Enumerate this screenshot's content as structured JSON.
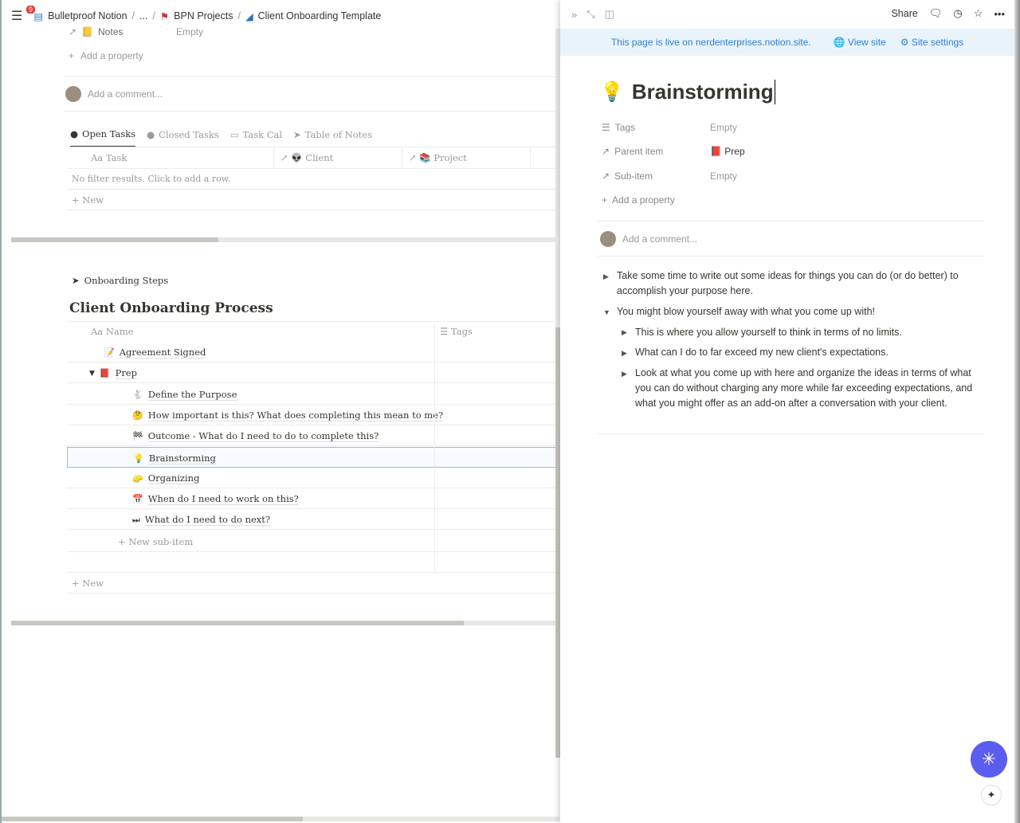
{
  "breadcrumb": {
    "badge": "9",
    "items": [
      "Bulletproof Notion",
      "...",
      "BPN Projects",
      "Client Onboarding Template"
    ]
  },
  "left": {
    "notes_prop": {
      "label": "Notes",
      "value": "Empty"
    },
    "add_property": "Add a property",
    "add_comment": "Add a comment...",
    "tabs": [
      "Open Tasks",
      "Closed Tasks",
      "Task Cal",
      "Table of Notes"
    ],
    "task_table": {
      "columns": [
        "Task",
        "Client",
        "Project"
      ],
      "empty": "No filter results. Click to add a row.",
      "new": "New"
    },
    "onboarding": {
      "view_label": "Onboarding Steps",
      "title": "Client Onboarding Process",
      "columns": [
        "Name",
        "Tags"
      ],
      "rows": [
        {
          "icon": "📝",
          "name": "Agreement Signed",
          "level": 0
        },
        {
          "icon": "📕",
          "name": "Prep",
          "level": 0
        },
        {
          "icon": "🐇",
          "name": "Define the Purpose",
          "level": 1
        },
        {
          "icon": "🤔",
          "name": "How important is this? What does completing this mean to me?",
          "level": 1
        },
        {
          "icon": "🏁",
          "name": "Outcome - What do I need to do to complete this?",
          "level": 1
        },
        {
          "icon": "💡",
          "name": "Brainstorming",
          "level": 1
        },
        {
          "icon": "🧽",
          "name": "Organizing",
          "level": 1
        },
        {
          "icon": "📅",
          "name": "When do I need to work on this?",
          "level": 1
        },
        {
          "icon": "⏭",
          "name": "What do I need to do next?",
          "level": 1
        }
      ],
      "new_sub": "New sub-item",
      "new": "New"
    }
  },
  "right": {
    "topbar": {
      "share": "Share"
    },
    "banner": {
      "text": "This page is live on nerdenterprises.notion.site.",
      "view_site": "View site",
      "site_settings": "Site settings"
    },
    "title": "Brainstorming",
    "props": [
      {
        "label": "Tags",
        "value": "Empty"
      },
      {
        "label": "Parent item",
        "value": "Prep"
      },
      {
        "label": "Sub-item",
        "value": "Empty"
      }
    ],
    "add_property": "Add a property",
    "add_comment": "Add a comment...",
    "bullets": [
      "Take some time to write out some ideas for things you can do (or do better) to accomplish your purpose here.",
      "You might blow yourself away with what you come up with!"
    ],
    "sub_bullets": [
      "This is where you allow yourself to think in terms of no limits.",
      "What can I do to far exceed my new client's expectations.",
      "Look at what you come up with here and organize the ideas in terms of what you can do without charging any more while far exceeding expectations, and what you might offer as an add-on after a conversation with your client."
    ]
  }
}
